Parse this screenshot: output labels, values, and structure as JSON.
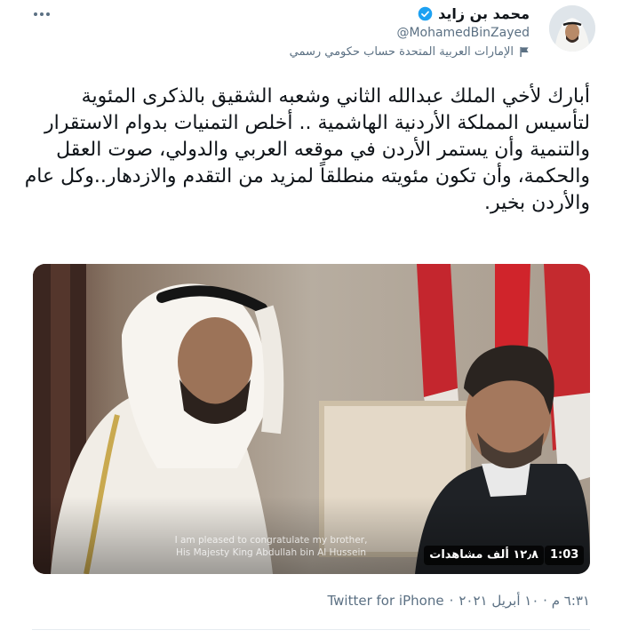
{
  "header": {
    "display_name": "محمد بن زايد",
    "handle": "@MohamedBinZayed",
    "account_label": "الإمارات العربية المتحدة حساب حكومي رسمي"
  },
  "tweet": {
    "text": "أبارك لأخي الملك عبدالله الثاني وشعبه الشقيق بالذكرى المئوية لتأسيس المملكة الأردنية الهاشمية .. أخلص التمنيات بدوام الاستقرار والتنمية وأن يستمر الأردن في موقعه العربي والدولي، صوت العقل والحكمة، وأن تكون مئويته منطلقاً لمزيد من التقدم والازدهار..وكل عام والأردن بخير."
  },
  "media": {
    "caption_line1": "I am pleased to congratulate my brother,",
    "caption_line2": "His Majesty King Abdullah bin Al Hussein",
    "duration": "1:03",
    "views": "١٢٫٨ ألف مشاهدات"
  },
  "meta": {
    "timestamp": "٦:٣١ م · ١٠ أبريل ٢٠٢١",
    "separator": "·",
    "source": "Twitter for iPhone"
  },
  "colors": {
    "verified": "#1da1f2",
    "secondary_text": "#5b7083",
    "primary_text": "#0f1419"
  }
}
